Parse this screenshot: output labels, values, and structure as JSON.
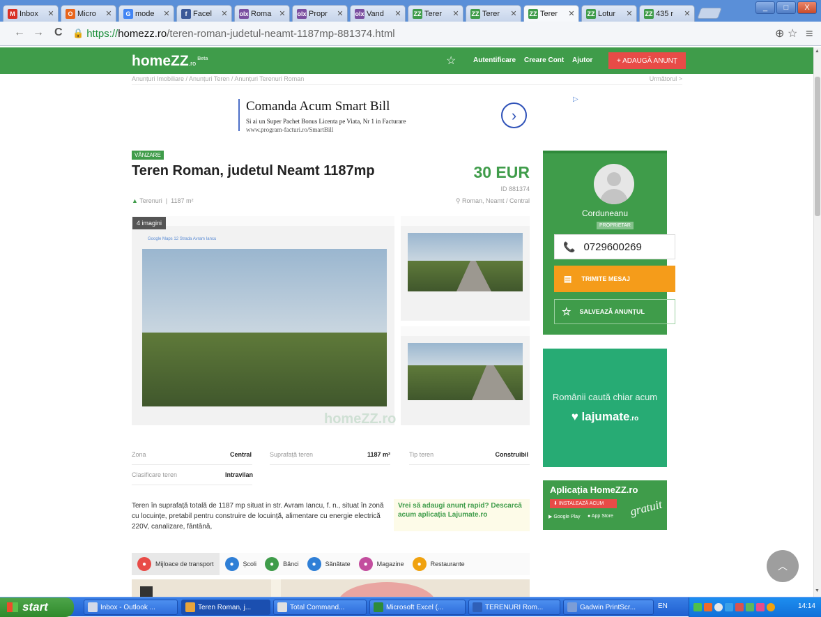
{
  "browser": {
    "tabs": [
      {
        "label": "Inbox",
        "icon": "gmail-icon",
        "color": "#d93025",
        "letter": "M"
      },
      {
        "label": "Micro",
        "icon": "outlook-icon",
        "color": "#e8641b",
        "letter": "O"
      },
      {
        "label": "mode",
        "icon": "google-icon",
        "color": "#4285f4",
        "letter": "G"
      },
      {
        "label": "Facel",
        "icon": "facebook-icon",
        "color": "#3b5998",
        "letter": "f"
      },
      {
        "label": "Roma",
        "icon": "olx-icon",
        "color": "#7a4fa0",
        "letter": "olx"
      },
      {
        "label": "Propr",
        "icon": "olx-icon",
        "color": "#7a4fa0",
        "letter": "olx"
      },
      {
        "label": "Vand",
        "icon": "olx-icon",
        "color": "#7a4fa0",
        "letter": "olx"
      },
      {
        "label": "Terer",
        "icon": "homezz-icon",
        "color": "#3f9c4a",
        "letter": "ZZ"
      },
      {
        "label": "Terer",
        "icon": "homezz-icon",
        "color": "#3f9c4a",
        "letter": "ZZ"
      },
      {
        "label": "Terer",
        "icon": "homezz-icon",
        "color": "#3f9c4a",
        "letter": "ZZ"
      },
      {
        "label": "Lotur",
        "icon": "homezz-icon",
        "color": "#3f9c4a",
        "letter": "ZZ"
      },
      {
        "label": "435 r",
        "icon": "homezz-icon",
        "color": "#3f9c4a",
        "letter": "ZZ"
      }
    ],
    "active_tab": 9,
    "tab_close": "✕",
    "nav": {
      "back": "←",
      "forward": "→",
      "reload": "C"
    },
    "url": {
      "scheme": "https://",
      "host": "homezz.ro",
      "path": "/teren-roman-judetul-neamt-1187mp-881374.html"
    },
    "window_buttons": {
      "min": "_",
      "max": "□",
      "close": "X"
    },
    "zoom_icon": "⊕",
    "star_icon": "☆",
    "menu_icon": "≡"
  },
  "site": {
    "logo": "homeZZ",
    "logo_tld": ".ro",
    "logo_beta": "Beta",
    "star": "☆",
    "login": "Autentificare",
    "register": "Creare Cont",
    "help": "Ajutor",
    "add_button": "+ ADAUGĂ ANUNȚ",
    "crumbs_left": "Anunțuri Imobiliare  /  Anunțuri Teren  /  Anunțuri Terenuri Roman",
    "crumbs_right": "Următorul >"
  },
  "ad": {
    "headline": "Comanda Acum Smart Bill",
    "line1": "Si ai un Super Pachet Bonus Licenta pe Viata, Nr 1 in Facturare",
    "line2": "www.program-facturi.ro/SmartBill",
    "go": "›",
    "choice": "▷"
  },
  "listing": {
    "badge": "VÂNZARE",
    "title": "Teren Roman, judetul Neamt 1187mp",
    "price": "30 EUR",
    "id": "ID 881374",
    "category": "Terenuri",
    "area": "1187 m²",
    "location": "Roman, Neamt / Central",
    "image_count": "4 imagini",
    "map_label": "Google Maps    12 Strada Avram Iancu",
    "watermark": "homeZZ.ro",
    "specs": [
      {
        "label": "Zona",
        "value": "Central"
      },
      {
        "label": "Suprafață teren",
        "value": "1187 m²"
      },
      {
        "label": "Tip teren",
        "value": "Construibil"
      },
      {
        "label": "Clasificare teren",
        "value": "Intravilan"
      }
    ],
    "description": "Teren în suprafață totală de 1187 mp situat in str. Avram Iancu, f. n., situat în zonă cu locuințe, pretabil pentru construire de locuință, alimentare cu energie electrică 220V, canalizare, fântână,",
    "app_banner": "Vrei să adaugi anunț rapid? Descarcă acum aplicația Lajumate.ro"
  },
  "seller": {
    "name": "Corduneanu",
    "role": "PROPRIETAR",
    "phone": "0729600269",
    "phone_icon": "📞",
    "message": "TRIMITE MESAJ",
    "save": "SALVEAZĂ ANUNȚUL",
    "save_icon": "☆"
  },
  "promo": {
    "text": "Românii caută chiar acum",
    "brand": "lajumate",
    "brand_tld": ".ro"
  },
  "app": {
    "title": "Aplicația HomeZZ.ro",
    "install": "INSTALEAZĂ ACUM",
    "google": "Google Play",
    "apple": "App Store",
    "free": "gratuit"
  },
  "pois": [
    {
      "label": "Mijloace de transport",
      "color": "#e84b47",
      "icon": "bus-icon"
    },
    {
      "label": "Școli",
      "color": "#2f7fd6",
      "icon": "school-icon"
    },
    {
      "label": "Bănci",
      "color": "#3f9c4a",
      "icon": "bank-icon"
    },
    {
      "label": "Sănătate",
      "color": "#2f7fd6",
      "icon": "health-icon"
    },
    {
      "label": "Magazine",
      "color": "#c34e9e",
      "icon": "shop-icon"
    },
    {
      "label": "Restaurante",
      "color": "#f0a20f",
      "icon": "restaurant-icon"
    }
  ],
  "taskbar": {
    "start": "start",
    "items": [
      {
        "label": "Inbox - Outlook ...",
        "color": "#d3d9e8"
      },
      {
        "label": "Teren Roman, j...",
        "color": "#e8a43a"
      },
      {
        "label": "Total Command...",
        "color": "#e0e0e0"
      },
      {
        "label": "Microsoft Excel (...",
        "color": "#2e8b3a"
      },
      {
        "label": "TERENURI Rom...",
        "color": "#2f5fb8"
      },
      {
        "label": "Gadwin PrintScr...",
        "color": "#7c9dd6"
      }
    ],
    "active": 1,
    "lang": "EN",
    "time": "14:14"
  },
  "colors": {
    "brand_green": "#3f9c4a",
    "add_red": "#e84b47",
    "message_orange": "#f59c1a",
    "promo_green": "#27ab74"
  }
}
